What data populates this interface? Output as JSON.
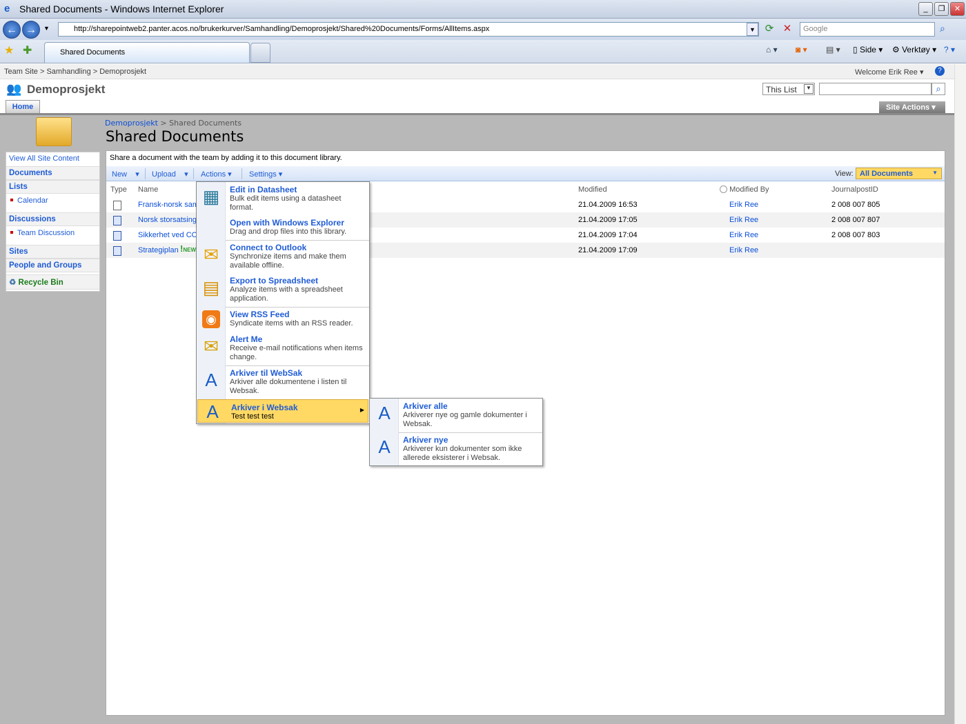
{
  "window": {
    "title": "Shared Documents - Windows Internet Explorer",
    "url": "http://sharepointweb2.panter.acos.no/brukerkurver/Samhandling/Demoprosjekt/Shared%20Documents/Forms/AllItems.aspx",
    "search_placeholder": "Google",
    "tab": "Shared Documents",
    "tools": {
      "page": "Side",
      "tools": "Verktøy"
    }
  },
  "site": {
    "breadcrumb": [
      "Team Site",
      "Samhandling",
      "Demoprosjekt"
    ],
    "welcome": "Welcome Erik Ree",
    "title": "Demoprosjekt",
    "scope": "This List",
    "home_tab": "Home",
    "site_actions": "Site Actions"
  },
  "page": {
    "breadcrumb": [
      "Demoprosjekt",
      "Shared Documents"
    ],
    "title": "Shared Documents",
    "description": "Share a document with the team by adding it to this document library."
  },
  "quicklaunch": {
    "view_all": "View All Site Content",
    "documents": "Documents",
    "lists": "Lists",
    "calendar": "Calendar",
    "discussions": "Discussions",
    "team_discussion": "Team Discussion",
    "sites": "Sites",
    "people": "People and Groups",
    "recycle": "Recycle Bin"
  },
  "toolbar": {
    "new": "New",
    "upload": "Upload",
    "actions": "Actions",
    "settings": "Settings",
    "view_label": "View:",
    "view": "All Documents"
  },
  "table": {
    "headers": [
      "Type",
      "Name",
      "Modified",
      "Modified By",
      "JournalpostID"
    ],
    "rows": [
      {
        "name": "Fransk-norsk sam",
        "modified": "21.04.2009 16:53",
        "by": "Erik Ree",
        "id": "2 008 007 805"
      },
      {
        "name": "Norsk storsatsing",
        "modified": "21.04.2009 17:05",
        "by": "Erik Ree",
        "id": "2 008 007 807"
      },
      {
        "name": "Sikkerhet ved CO",
        "modified": "21.04.2009 17:04",
        "by": "Erik Ree",
        "id": "2 008 007 803"
      },
      {
        "name": "Strategiplan",
        "new": "NEW",
        "modified": "21.04.2009 17:09",
        "by": "Erik Ree",
        "id": ""
      }
    ]
  },
  "actions_menu": [
    {
      "title": "Edit in Datasheet",
      "desc": "Bulk edit items using a datasheet format.",
      "icon": "datasheet-icon"
    },
    {
      "title": "Open with Windows Explorer",
      "desc": "Drag and drop files into this library.",
      "icon": "none"
    },
    {
      "title": "Connect to Outlook",
      "desc": "Synchronize items and make them available offline.",
      "icon": "outlook-icon"
    },
    {
      "title": "Export to Spreadsheet",
      "desc": "Analyze items with a spreadsheet application.",
      "icon": "spreadsheet-icon"
    },
    {
      "title": "View RSS Feed",
      "desc": "Syndicate items with an RSS reader.",
      "icon": "rss-icon"
    },
    {
      "title": "Alert Me",
      "desc": "Receive e-mail notifications when items change.",
      "icon": "alert-icon"
    },
    {
      "title": "Arkiver til WebSak",
      "desc": "Arkiver alle dokumentene i listen til Websak.",
      "icon": "websak-icon"
    },
    {
      "title": "Arkiver i Websak",
      "desc": "Test test test",
      "icon": "websak-icon"
    }
  ],
  "submenu": [
    {
      "title": "Arkiver alle",
      "desc": "Arkiverer nye og gamle dokumenter i Websak."
    },
    {
      "title": "Arkiver nye",
      "desc": "Arkiverer kun dokumenter som ikke allerede eksisterer i Websak."
    }
  ],
  "colors": {
    "link": "#0a4fd8",
    "highlight": "#ffd964"
  }
}
